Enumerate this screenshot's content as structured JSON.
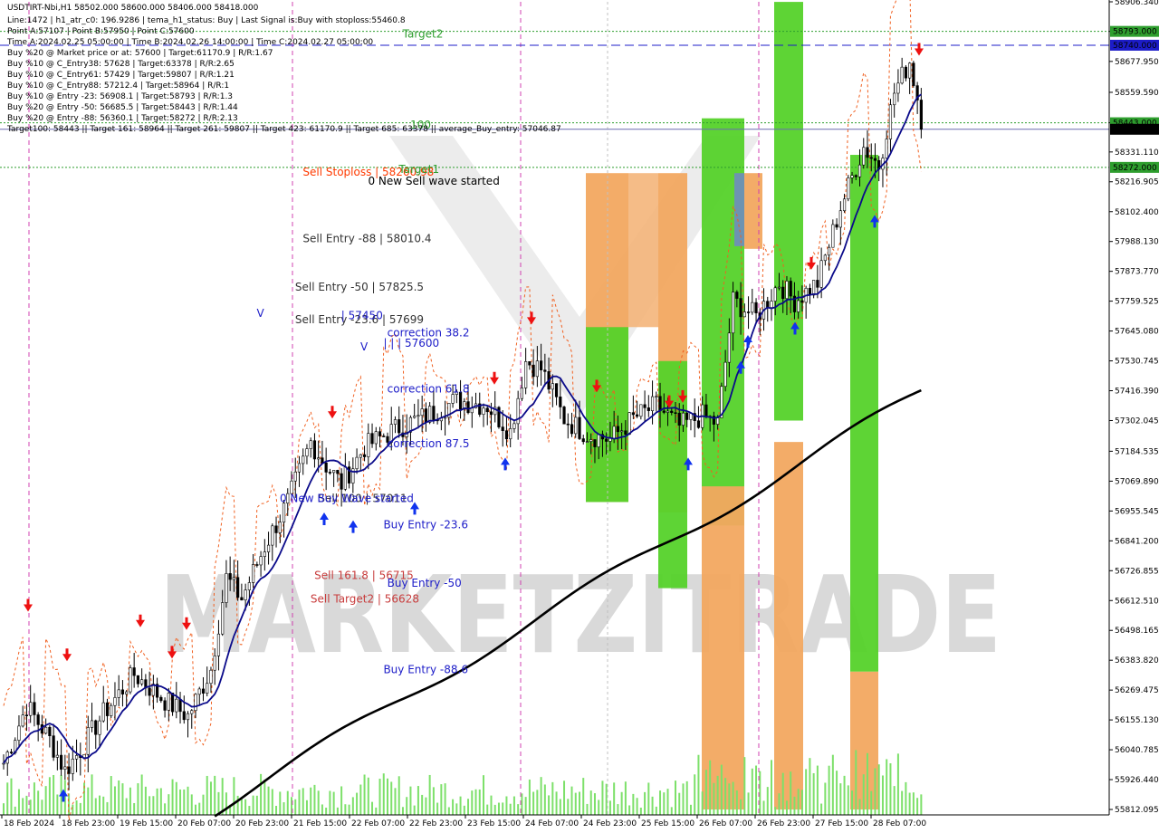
{
  "header": {
    "lines": [
      "USDTIRT-Nbi,H1  58502.000 58600.000 58406.000 58418.000",
      "Line:1472 | h1_atr_c0: 196.9286 | tema_h1_status: Buy | Last Signal is:Buy with stoploss:55460.8",
      "Point A:57107 | Point B:57950 | Point C:57600",
      "Time A:2024.02.25 05:00:00 | Time B:2024.02.26 14:00:00 | Time C:2024.02.27 05:00:00",
      "Buy %20 @ Market price or at: 57600 | Target:61170.9 | R/R:1.67",
      "Buy %10 @ C_Entry38: 57628 | Target:63378 | R/R:2.65",
      "Buy %10 @ C_Entry61: 57429 | Target:59807 | R/R:1.21",
      "Buy %10 @ C_Entry88: 57212.4 | Target:58964 | R/R:1",
      "Buy %10 @ Entry -23: 56908.1 | Target:58793 | R/R:1.3",
      "Buy %20 @ Entry -50: 56685.5 | Target:58443 | R/R:1.44",
      "Buy %20 @ Entry -88: 56360.1 | Target:58272 | R/R:2.13",
      "Target100: 58443 || Target 161: 58964 || Target 261: 59807 || Target 423: 61170.9 || Target 685: 63378 || average_Buy_entry: 57046.87"
    ]
  },
  "watermark": "MARKETZITRADE",
  "chart_data": {
    "type": "candlestick",
    "symbol": "USDTIRT-Nbi,H1",
    "ylim": [
      55812.095,
      58906.34
    ],
    "y_ticks": [
      58906.34,
      58793.0,
      58677.95,
      58559.59,
      58443.0,
      58331.11,
      58216.905,
      58102.4,
      57988.13,
      57873.77,
      57759.525,
      57645.08,
      57530.745,
      57416.39,
      57302.045,
      57184.535,
      57069.89,
      56955.545,
      56841.2,
      56726.855,
      56612.51,
      56498.165,
      56383.82,
      56269.475,
      56155.13,
      56040.785,
      55926.44,
      55812.095
    ],
    "x_ticks": [
      "18 Feb 2024",
      "18 Feb 23:00",
      "19 Feb 15:00",
      "20 Feb 07:00",
      "20 Feb 23:00",
      "21 Feb 15:00",
      "22 Feb 07:00",
      "22 Feb 23:00",
      "23 Feb 15:00",
      "24 Feb 07:00",
      "24 Feb 23:00",
      "25 Feb 15:00",
      "26 Feb 07:00",
      "26 Feb 23:00",
      "27 Feb 15:00",
      "28 Feb 07:00"
    ],
    "price_tags": [
      {
        "value": 58793.0,
        "label": "58793.000",
        "color": "#2e9e2e"
      },
      {
        "value": 58740.0,
        "label": "58740.000",
        "color": "#1c1cc8"
      },
      {
        "value": 58443.0,
        "label": "58443.000",
        "color": "#2e9e2e"
      },
      {
        "value": 58418.0,
        "label": "58418.000",
        "color": "#000000"
      },
      {
        "value": 58272.0,
        "label": "58272.000",
        "color": "#2e9e2e"
      }
    ],
    "levels": [
      {
        "value": 58793.0,
        "color": "#2e9e2e",
        "style": "dotted"
      },
      {
        "value": 58740.0,
        "color": "#1c1cc8",
        "style": "dashed"
      },
      {
        "value": 58443.0,
        "color": "#2e9e2e",
        "style": "dotted"
      },
      {
        "value": 58418.0,
        "color": "#6b6bb0",
        "style": "solid"
      },
      {
        "value": 58272.0,
        "color": "#2e9e2e",
        "style": "dotted"
      }
    ],
    "annotations": [
      {
        "text": "Sell Stoploss | 58260.98",
        "price": 58240,
        "bar": 85,
        "color": "#ff3a00"
      },
      {
        "text": "Sell Entry -88 | 58010.4",
        "price": 57985,
        "bar": 85,
        "color": "#333333"
      },
      {
        "text": "Sell Entry -50 | 57825.5",
        "price": 57800,
        "bar": 83,
        "color": "#333333"
      },
      {
        "text": "Sell Entry -23.6 | 57699",
        "price": 57675,
        "bar": 83,
        "color": "#333333"
      },
      {
        "text": "Sell 100 | 57011",
        "price": 56990,
        "bar": 89,
        "color": "#333333"
      },
      {
        "text": "0 New Buy Wave started",
        "price": 56990,
        "bar": 79,
        "color": "#1c1cc8"
      },
      {
        "text": "Sell 161.8 | 56715",
        "price": 56695,
        "bar": 88,
        "color": "#c83c3c"
      },
      {
        "text": "Sell Target2 | 56628",
        "price": 56605,
        "bar": 87,
        "color": "#c83c3c"
      },
      {
        "text": "Target2",
        "price": 58770,
        "bar": 111,
        "color": "#2e9e2e"
      },
      {
        "text": "Target1",
        "price": 58250,
        "bar": 110,
        "color": "#2e9e2e"
      },
      {
        "text": "0 New Sell wave started",
        "price": 58205,
        "bar": 102,
        "color": "#000000"
      },
      {
        "text": "100",
        "price": 58420,
        "bar": 113,
        "color": "#2e9e2e"
      },
      {
        "text": "| | | 57600",
        "price": 57585,
        "bar": 106,
        "color": "#1c1cc8"
      },
      {
        "text": "correction 38.2",
        "price": 57625,
        "bar": 107,
        "color": "#1c1cc8"
      },
      {
        "text": "correction 61.8",
        "price": 57410,
        "bar": 107,
        "color": "#1c1cc8"
      },
      {
        "text": "correction 87.5",
        "price": 57200,
        "bar": 107,
        "color": "#1c1cc8"
      },
      {
        "text": "Buy Entry -23.6",
        "price": 56890,
        "bar": 106,
        "color": "#1c1cc8"
      },
      {
        "text": "Buy Entry -50",
        "price": 56665,
        "bar": 107,
        "color": "#1c1cc8"
      },
      {
        "text": "Buy Entry -88.6",
        "price": 56335,
        "bar": 106,
        "color": "#1c1cc8"
      },
      {
        "text": "| 57450",
        "price": 57690,
        "bar": 95,
        "color": "#1c1cc8"
      },
      {
        "text": "V",
        "price": 57700,
        "bar": 73,
        "color": "#1c1cc8"
      },
      {
        "text": "V",
        "price": 57570,
        "bar": 100,
        "color": "#1c1cc8"
      }
    ]
  }
}
